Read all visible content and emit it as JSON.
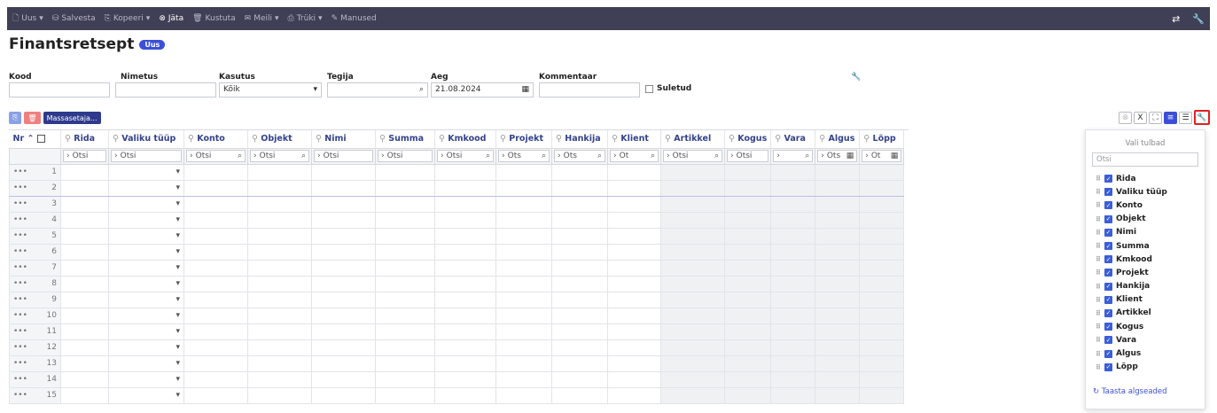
{
  "toolbar": {
    "items": [
      {
        "label": "Uus",
        "icon": "document-icon",
        "caret": "▾"
      },
      {
        "label": "Salvesta",
        "icon": "save-icon"
      },
      {
        "label": "Kopeeri",
        "icon": "copy-icon",
        "caret": "▾"
      },
      {
        "label": "Jäta",
        "icon": "cancel-icon"
      },
      {
        "label": "Kustuta",
        "icon": "trash-icon"
      },
      {
        "label": "Meili",
        "icon": "mail-icon",
        "caret": "▾"
      },
      {
        "label": "Trüki",
        "icon": "print-icon",
        "caret": "▾"
      },
      {
        "label": "Manused",
        "icon": "paperclip-icon"
      }
    ]
  },
  "page": {
    "title": "Finantsretsept",
    "badge": "Uus"
  },
  "filters": {
    "kood": {
      "label": "Kood",
      "value": ""
    },
    "nimetus": {
      "label": "Nimetus",
      "value": ""
    },
    "kasutus": {
      "label": "Kasutus",
      "value": "Kõik"
    },
    "tegija": {
      "label": "Tegija",
      "value": ""
    },
    "aeg": {
      "label": "Aeg",
      "value": "21.08.2024"
    },
    "kommentaar": {
      "label": "Kommentaar",
      "value": ""
    },
    "suletud": {
      "label": "Suletud",
      "checked": false
    }
  },
  "actions": {
    "mass_label": "Massasetaja..."
  },
  "grid": {
    "nr_header": "Nr",
    "columns": [
      "Rida",
      "Valiku tüüp",
      "Konto",
      "Objekt",
      "Nimi",
      "Summa",
      "Kmkood",
      "Projekt",
      "Hankija",
      "Klient",
      "Artikkel",
      "Kogus",
      "Vara",
      "Algus",
      "Lõpp"
    ],
    "search": [
      "Otsi",
      "Otsi",
      "Otsi",
      "Otsi",
      "Otsi",
      "Otsi",
      "Otsi",
      "Ots",
      "Ots",
      "Ot",
      "Otsi",
      "Otsi",
      "",
      "Ots",
      "Ot"
    ],
    "row_numbers": [
      "1",
      "2",
      "3",
      "4",
      "5",
      "6",
      "7",
      "8",
      "9",
      "10",
      "11",
      "12",
      "13",
      "14",
      "15"
    ],
    "row_menu": "•••"
  },
  "column_panel": {
    "title": "Vali tulbad",
    "search_placeholder": "Otsi",
    "items": [
      "Rida",
      "Valiku tüüp",
      "Konto",
      "Objekt",
      "Nimi",
      "Summa",
      "Kmkood",
      "Projekt",
      "Hankija",
      "Klient",
      "Artikkel",
      "Kogus",
      "Vara",
      "Algus",
      "Lõpp"
    ],
    "reset_label": "Taasta algseaded"
  },
  "colors": {
    "toolbar_bg": "#3f3f55",
    "accent": "#3b4fd8",
    "highlight": "#e02020"
  }
}
